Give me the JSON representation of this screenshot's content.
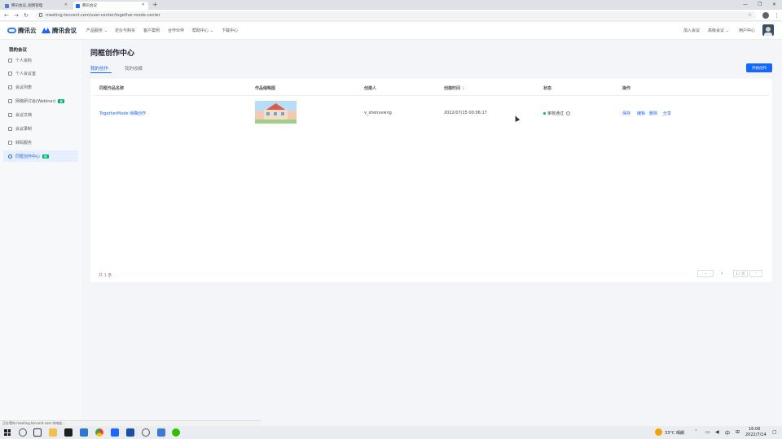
{
  "browser": {
    "tabs": [
      {
        "title": "腾讯会议_视频管理"
      },
      {
        "title": "腾讯会议"
      }
    ],
    "url": "meeting.tencent.com/user-center/together-mode-center",
    "status_text": "正在等待 meeting.tencent.com 的响应..."
  },
  "header": {
    "brand1": "腾讯云",
    "brand2": "腾讯会议",
    "nav": [
      "产品服务 ⌄",
      "定价与购买",
      "客户案例",
      "合作伙伴",
      "帮助中心 ⌄",
      "下载中心"
    ],
    "right": [
      "加入会议",
      "高级会议 ⌄",
      "用户中心"
    ]
  },
  "sidebar": {
    "title": "我的会议",
    "items": [
      {
        "label": "个人资料",
        "icon": "user-icon"
      },
      {
        "label": "个人会议室",
        "icon": "room-icon"
      },
      {
        "label": "会议列表",
        "icon": "list-icon"
      },
      {
        "label": "网络研讨会(Webinar)",
        "icon": "webinar-icon",
        "badge": "新"
      },
      {
        "label": "会议文档",
        "icon": "document-icon"
      },
      {
        "label": "会议录制",
        "icon": "record-icon"
      },
      {
        "label": "转码服务",
        "icon": "transcode-icon"
      },
      {
        "label": "同框创作中心",
        "icon": "together-icon",
        "badge": "新",
        "active": true
      }
    ]
  },
  "main": {
    "title": "同框创作中心",
    "tabs": [
      "我的创作",
      "我的收藏"
    ],
    "start_button": "开始创作",
    "columns": [
      "同框作品名称",
      "作品缩略图",
      "创建人",
      "创建时间",
      "状态",
      "操作"
    ],
    "sort_indicator": "↓",
    "rows": [
      {
        "name": "TogetherMode 待确创作",
        "creator": "v_shenvvwng",
        "created": "2022/07/15 00:06:17",
        "status": "审核通过",
        "actions": [
          "保存",
          "编辑",
          "删除",
          "分享"
        ]
      }
    ],
    "total": "共 1 条",
    "pagination": {
      "page_size": "1 / 页",
      "prev": "‹",
      "next": "›"
    }
  },
  "taskbar": {
    "weather": "33°C 晴朗",
    "ime": "中",
    "time": "16:06",
    "date": "2022/7/14"
  },
  "colors": {
    "accent": "#1667ff",
    "success": "#00b36b"
  }
}
